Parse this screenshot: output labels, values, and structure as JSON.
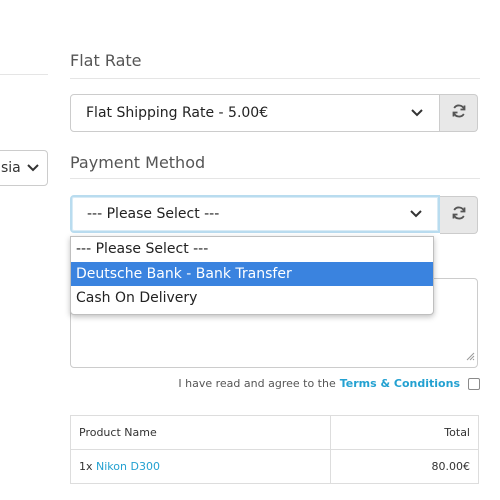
{
  "left": {
    "select_value": "sia"
  },
  "shipping": {
    "title": "Flat Rate",
    "selected": "Flat Shipping Rate - 5.00€"
  },
  "payment": {
    "title": "Payment Method",
    "selected": "--- Please Select ---",
    "options": [
      "--- Please Select ---",
      "Deutsche Bank - Bank Transfer",
      "Cash On Delivery"
    ],
    "highlighted_option": "Deutsche Bank - Bank Transfer"
  },
  "agree": {
    "text": "I have read and agree to the",
    "link": "Terms & Conditions"
  },
  "order_table": {
    "headers": [
      "Product Name",
      "Total"
    ],
    "rows": [
      {
        "qty": "1x",
        "product": "Nikon D300",
        "total": "80.00€"
      }
    ]
  },
  "icons": {
    "chevron": "chevron-down-icon",
    "refresh": "refresh-icon",
    "resize": "resize-grip-icon"
  },
  "colors": {
    "link": "#23a1d1",
    "highlight": "#3a83df",
    "focus_border": "#b9dcef",
    "button_bg": "#e8e8e8"
  }
}
